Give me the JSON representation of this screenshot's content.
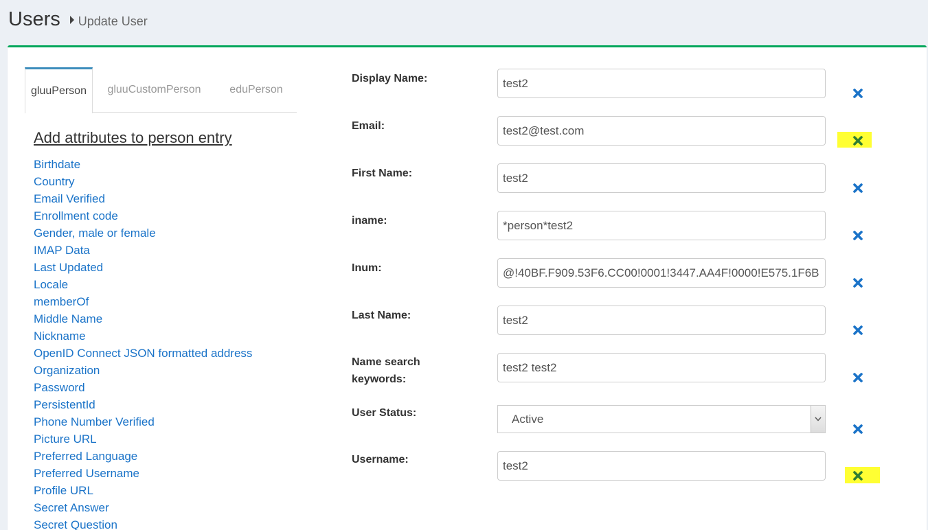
{
  "header": {
    "title": "Users",
    "breadcrumb": "Update User"
  },
  "tabs": [
    {
      "label": "gluuPerson",
      "active": true
    },
    {
      "label": "gluuCustomPerson",
      "active": false
    },
    {
      "label": "eduPerson",
      "active": false
    }
  ],
  "attributes": {
    "heading": "Add attributes to person entry",
    "items": [
      "Birthdate",
      "Country",
      "Email Verified",
      "Enrollment code",
      "Gender, male or female",
      "IMAP Data",
      "Last Updated",
      "Locale",
      "memberOf",
      "Middle Name",
      "Nickname",
      "OpenID Connect JSON formatted address",
      "Organization",
      "Password",
      "PersistentId",
      "Phone Number Verified",
      "Picture URL",
      "Preferred Language",
      "Preferred Username",
      "Profile URL",
      "Secret Answer",
      "Secret Question"
    ]
  },
  "form": {
    "display_name": {
      "label": "Display Name:",
      "value": "test2"
    },
    "email": {
      "label": "Email:",
      "value": "test2@test.com"
    },
    "first_name": {
      "label": "First Name:",
      "value": "test2"
    },
    "iname": {
      "label": "iname:",
      "value": "*person*test2"
    },
    "inum": {
      "label": "Inum:",
      "value": "@!40BF.F909.53F6.CC00!0001!3447.AA4F!0000!E575.1F6B"
    },
    "last_name": {
      "label": "Last Name:",
      "value": "test2"
    },
    "name_search": {
      "label_line1": "Name search",
      "label_line2": "keywords:",
      "value": "test2 test2"
    },
    "user_status": {
      "label": "User Status:",
      "value": "Active"
    },
    "username": {
      "label": "Username:",
      "value": "test2"
    }
  },
  "colors": {
    "accent": "#00a65a",
    "link": "#1a73c8",
    "remove_icon": "#1a73c8",
    "highlight": "#ffff33",
    "highlighted_icon": "#2e7d32"
  },
  "icons": {
    "remove": "close-icon",
    "breadcrumb_sep": "caret-right-icon"
  }
}
